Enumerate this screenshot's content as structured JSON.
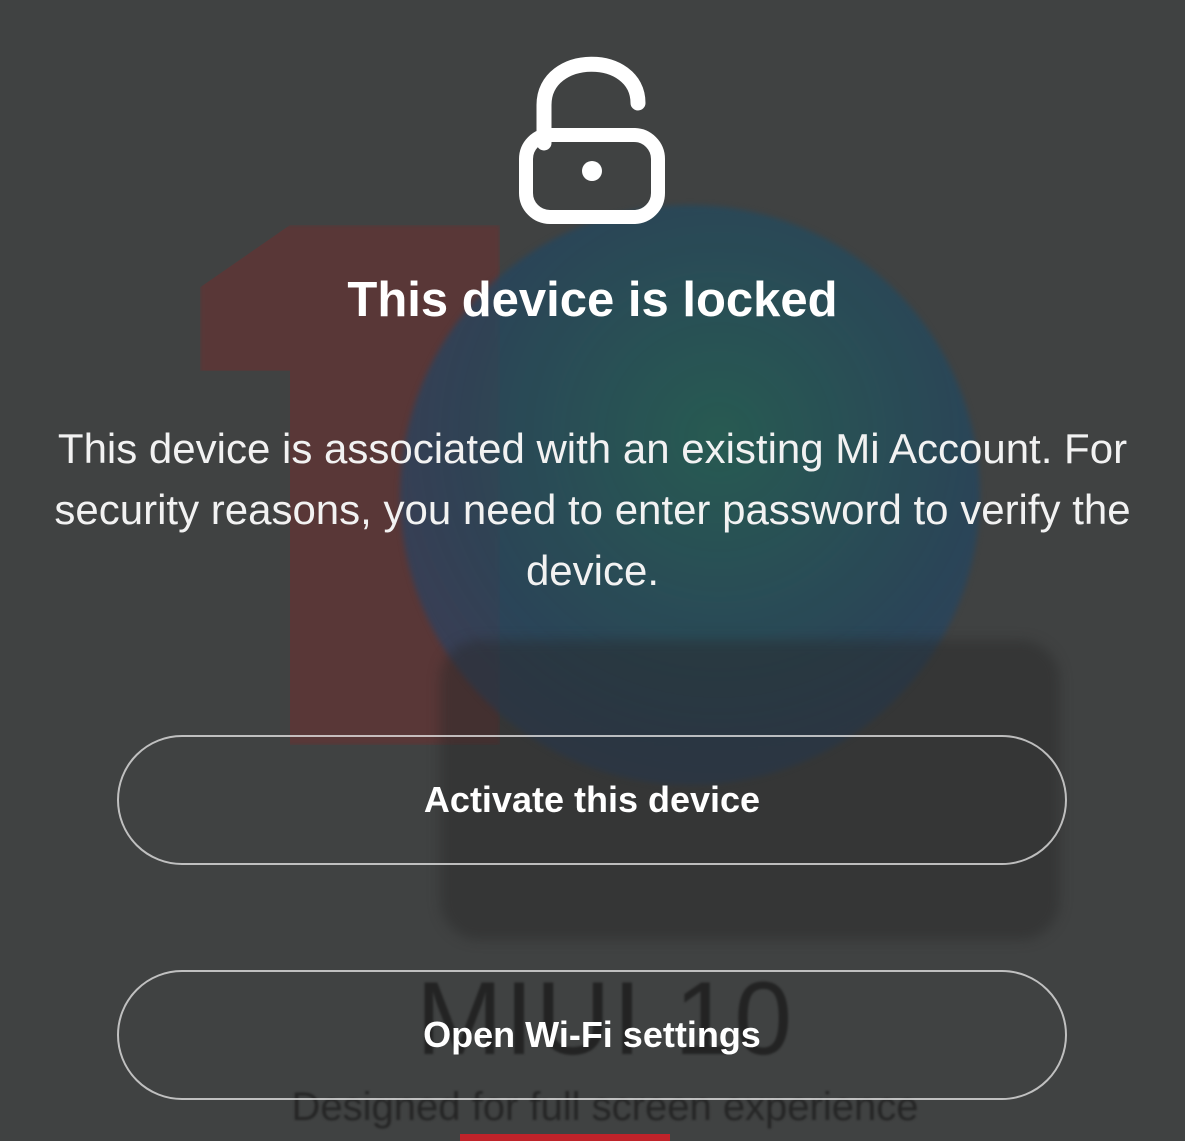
{
  "lock_screen": {
    "icon": "unlocked-padlock-icon",
    "title": "This device is locked",
    "message": "This device is associated with an existing Mi Account. For security reasons, you need to enter password to verify the device.",
    "buttons": {
      "activate_label": "Activate this device",
      "wifi_label": "Open Wi-Fi settings"
    }
  },
  "background": {
    "watermark": "MIUI 10",
    "tagline": "Designed for full screen experience"
  },
  "colors": {
    "background": "#404242",
    "text": "#ffffff",
    "accent_bar": "#c0232a"
  }
}
